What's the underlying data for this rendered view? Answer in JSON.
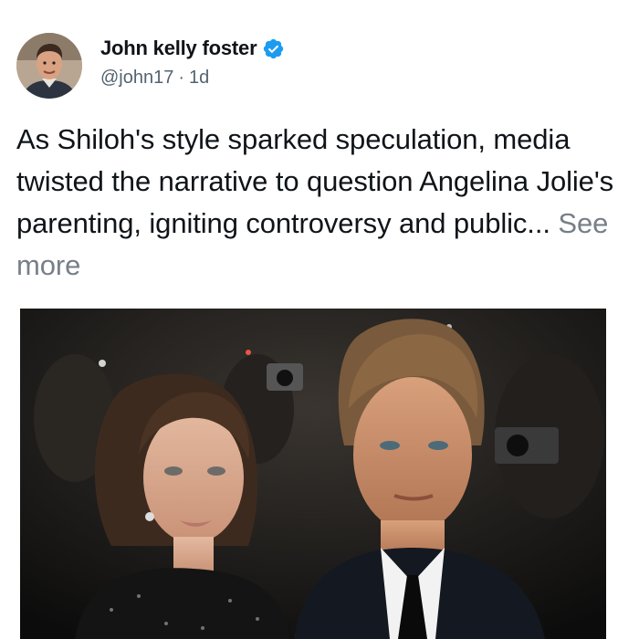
{
  "author": {
    "display_name": "John kelly foster",
    "handle": "@john17",
    "separator": "·",
    "time_ago": "1d",
    "verified": true,
    "avatar_icon": "user-avatar-photo",
    "verified_icon": "verified-badge-icon",
    "verified_color": "#1d9bf0"
  },
  "tweet": {
    "text": "As Shiloh's style sparked speculation, media twisted the narrative to question Angelina Jolie's parenting, igniting controversy and public...",
    "see_more_label": "See more"
  },
  "media": {
    "type": "photo",
    "icon": "couple-red-carpet-photo"
  }
}
